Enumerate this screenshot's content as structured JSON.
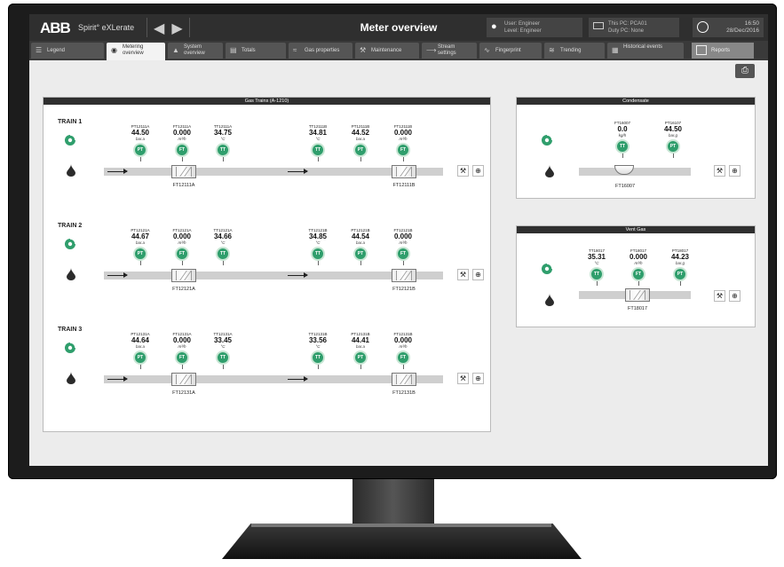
{
  "header": {
    "logo": "ABB",
    "app_name": "Spirit° eXLerate",
    "title": "Meter overview",
    "user_line1": "User:   Engineer",
    "user_line2": "Level:   Engineer",
    "pc_line1": "This PC: PCA01",
    "pc_line2": "Duty PC: None",
    "time": "16:50",
    "date": "28/Dec/2016"
  },
  "tabs": [
    {
      "label": "Legend",
      "icon": "legend-icon"
    },
    {
      "label": "Metering overview",
      "icon": "gauge-icon"
    },
    {
      "label": "System overview",
      "icon": "system-icon"
    },
    {
      "label": "Totals",
      "icon": "totals-icon"
    },
    {
      "label": "Gas properties",
      "icon": "gas-icon"
    },
    {
      "label": "Maintenance",
      "icon": "wrench-icon"
    },
    {
      "label": "Stream settings",
      "icon": "stream-icon"
    },
    {
      "label": "Fingerprint",
      "icon": "fingerprint-icon"
    },
    {
      "label": "Trending",
      "icon": "trend-icon"
    },
    {
      "label": "Historical events",
      "icon": "history-icon"
    }
  ],
  "reports_label": "Reports",
  "gas_trains": {
    "title": "Gas Trains (A-1210)",
    "trains": [
      {
        "label": "TRAIN 1",
        "left_meter": "FT12111A",
        "right_meter": "FT12111B",
        "instruments": [
          {
            "tag": "PT12111A",
            "value": "44.50",
            "unit": "bar.a",
            "type": "PT"
          },
          {
            "tag": "FT12111A",
            "value": "0.000",
            "unit": "m³/h",
            "type": "FT"
          },
          {
            "tag": "TT12111A",
            "value": "34.75",
            "unit": "°C",
            "type": "TT"
          },
          {
            "tag": "TT12111B",
            "value": "34.81",
            "unit": "°C",
            "type": "TT"
          },
          {
            "tag": "PT12111B",
            "value": "44.52",
            "unit": "bar.a",
            "type": "PT"
          },
          {
            "tag": "FT12111B",
            "value": "0.000",
            "unit": "m³/h",
            "type": "FT"
          }
        ]
      },
      {
        "label": "TRAIN 2",
        "left_meter": "FT12121A",
        "right_meter": "FT12121B",
        "instruments": [
          {
            "tag": "PT12121A",
            "value": "44.67",
            "unit": "bar.a",
            "type": "PT"
          },
          {
            "tag": "FT12121A",
            "value": "0.000",
            "unit": "m³/h",
            "type": "FT"
          },
          {
            "tag": "TT12121A",
            "value": "34.66",
            "unit": "°C",
            "type": "TT"
          },
          {
            "tag": "TT12121B",
            "value": "34.85",
            "unit": "°C",
            "type": "TT"
          },
          {
            "tag": "PT12121B",
            "value": "44.54",
            "unit": "bar.a",
            "type": "PT"
          },
          {
            "tag": "FT12121B",
            "value": "0.000",
            "unit": "m³/h",
            "type": "FT"
          }
        ]
      },
      {
        "label": "TRAIN 3",
        "left_meter": "FT12131A",
        "right_meter": "FT12131B",
        "instruments": [
          {
            "tag": "PT12131A",
            "value": "44.64",
            "unit": "bar.a",
            "type": "PT"
          },
          {
            "tag": "FT12131A",
            "value": "0.000",
            "unit": "m³/h",
            "type": "FT"
          },
          {
            "tag": "TT12131A",
            "value": "33.45",
            "unit": "°C",
            "type": "TT"
          },
          {
            "tag": "TT12131B",
            "value": "33.56",
            "unit": "°C",
            "type": "TT"
          },
          {
            "tag": "PT12131B",
            "value": "44.41",
            "unit": "bar.a",
            "type": "PT"
          },
          {
            "tag": "FT12131B",
            "value": "0.000",
            "unit": "m³/h",
            "type": "FT"
          }
        ]
      }
    ]
  },
  "condensate": {
    "title": "Condensate",
    "meter": "FT16007",
    "instruments": [
      {
        "tag": "FT16007",
        "value": "0.0",
        "unit": "kg/h",
        "type": "TT"
      },
      {
        "tag": "PT16107",
        "value": "44.50",
        "unit": "bar.g",
        "type": "PT"
      }
    ]
  },
  "vent_gas": {
    "title": "Vent Gas",
    "meter": "FT18017",
    "instruments": [
      {
        "tag": "TT18017",
        "value": "35.31",
        "unit": "°C",
        "type": "TT"
      },
      {
        "tag": "FT18017",
        "value": "0.000",
        "unit": "m³/h",
        "type": "FT"
      },
      {
        "tag": "PT18017",
        "value": "44.23",
        "unit": "bar.g",
        "type": "PT"
      }
    ]
  },
  "colors": {
    "accent_green": "#2f9e6c",
    "header_bg": "#2f2f2f"
  }
}
